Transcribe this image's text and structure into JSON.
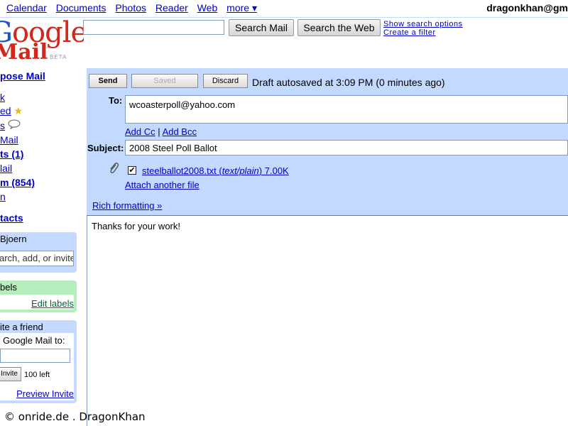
{
  "topnav": {
    "items": [
      "Calendar",
      "Documents",
      "Photos",
      "Reader",
      "Web",
      "more ▾"
    ],
    "user": "dragonkhan@gm"
  },
  "logo": {
    "google": "Google",
    "mail": "Mail",
    "beta": "BETA"
  },
  "search": {
    "value": "",
    "search_mail": "Search Mail",
    "search_web": "Search the Web",
    "show_options": "Show search options",
    "create_filter": "Create a filter"
  },
  "sidebar": {
    "compose": "pose Mail",
    "items": [
      "k",
      "ed",
      "s",
      "Mail",
      "ts (1)",
      "lail",
      "m (854)",
      "n"
    ],
    "contacts": "tacts",
    "chat": {
      "header": "Bjoern",
      "input": "arch, add, or invite"
    },
    "labels": {
      "header": "bels",
      "edit": "Edit labels"
    },
    "invite": {
      "header": "ite a friend",
      "line": "Google Mail to:",
      "button": "Invite",
      "left": "100 left",
      "preview": "Preview Invite"
    }
  },
  "compose": {
    "send": "Send",
    "saved": "Saved",
    "discard": "Discard",
    "autosave": "Draft autosaved at 3:09 PM (0 minutes ago)",
    "to_label": "To:",
    "to_value": "wcoasterpoll@yahoo.com",
    "add_cc": "Add Cc",
    "separator": "|",
    "add_bcc": "Add Bcc",
    "subject_label": "Subject:",
    "subject_value": "2008 Steel Poll Ballot",
    "attachment": {
      "name": "steelballot2008.txt",
      "type": "text/plain",
      "size": "7.00K",
      "checked": "✔"
    },
    "attach_another": "Attach another file",
    "rich_formatting": "Rich formatting »",
    "body": "Thanks for your work!"
  },
  "footer": {
    "copyright": "© onride.de . DragonKhan"
  }
}
